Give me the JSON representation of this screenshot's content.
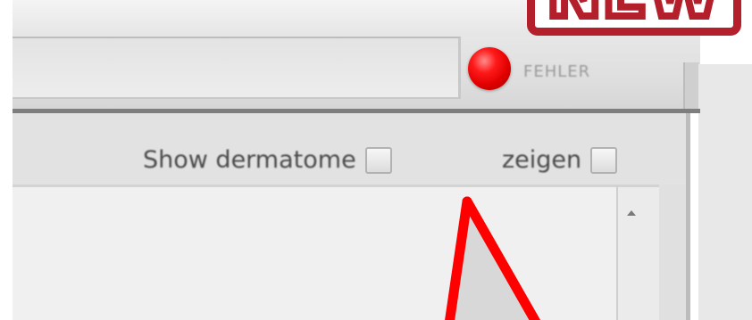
{
  "toolbar": {
    "search_value": "",
    "error_label": "FEHLER"
  },
  "badge": {
    "text": "NEW"
  },
  "options": {
    "show_dermatome_label": "Show dermatome",
    "show_dermatome_checked": false,
    "zeigen_label": "zeigen",
    "zeigen_checked": false
  },
  "colors": {
    "error_dot": "#e10000",
    "badge_red": "#b3202b",
    "annotation_arrow": "#ff0000"
  },
  "icons": {
    "scroll_up": "scroll-up-arrow-icon",
    "status": "red-status-dot-icon",
    "annotation": "pointer-arrow-annotation"
  }
}
